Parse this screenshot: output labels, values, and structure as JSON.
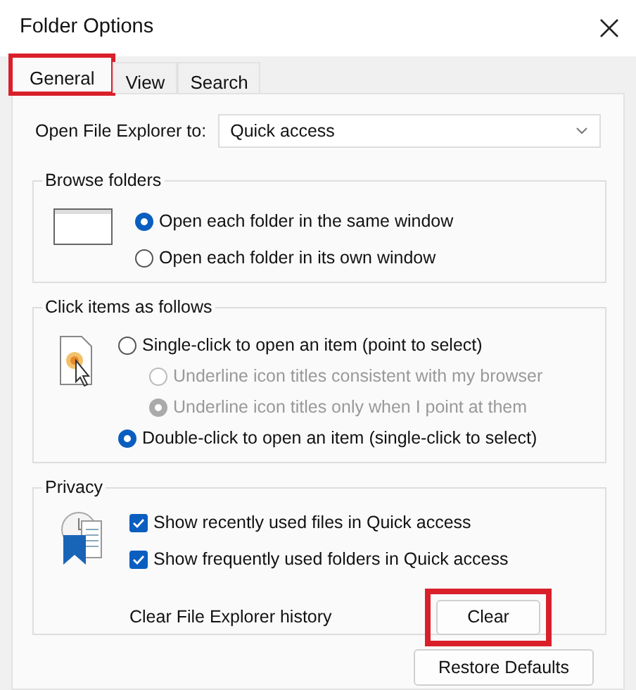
{
  "window": {
    "title": "Folder Options"
  },
  "tabs": [
    {
      "label": "General",
      "selected": true,
      "highlighted": true
    },
    {
      "label": "View",
      "selected": false,
      "highlighted": false
    },
    {
      "label": "Search",
      "selected": false,
      "highlighted": false
    }
  ],
  "open_to": {
    "label": "Open File Explorer to:",
    "value": "Quick access"
  },
  "browse_folders": {
    "title": "Browse folders",
    "options": [
      {
        "label": "Open each folder in the same window",
        "selected": true
      },
      {
        "label": "Open each folder in its own window",
        "selected": false
      }
    ]
  },
  "click_items": {
    "title": "Click items as follows",
    "options": [
      {
        "label": "Single-click to open an item (point to select)",
        "selected": false,
        "disabled": false,
        "children": [
          {
            "label": "Underline icon titles consistent with my browser",
            "selected": false,
            "disabled": true
          },
          {
            "label": "Underline icon titles only when I point at them",
            "selected": true,
            "disabled": true
          }
        ]
      },
      {
        "label": "Double-click to open an item (single-click to select)",
        "selected": true,
        "disabled": false
      }
    ]
  },
  "privacy": {
    "title": "Privacy",
    "checks": [
      {
        "label": "Show recently used files in Quick access",
        "checked": true
      },
      {
        "label": "Show frequently used folders in Quick access",
        "checked": true
      }
    ],
    "clear_label": "Clear File Explorer history",
    "clear_button": {
      "label": "Clear",
      "highlighted": true
    }
  },
  "restore_button": {
    "label": "Restore Defaults"
  }
}
